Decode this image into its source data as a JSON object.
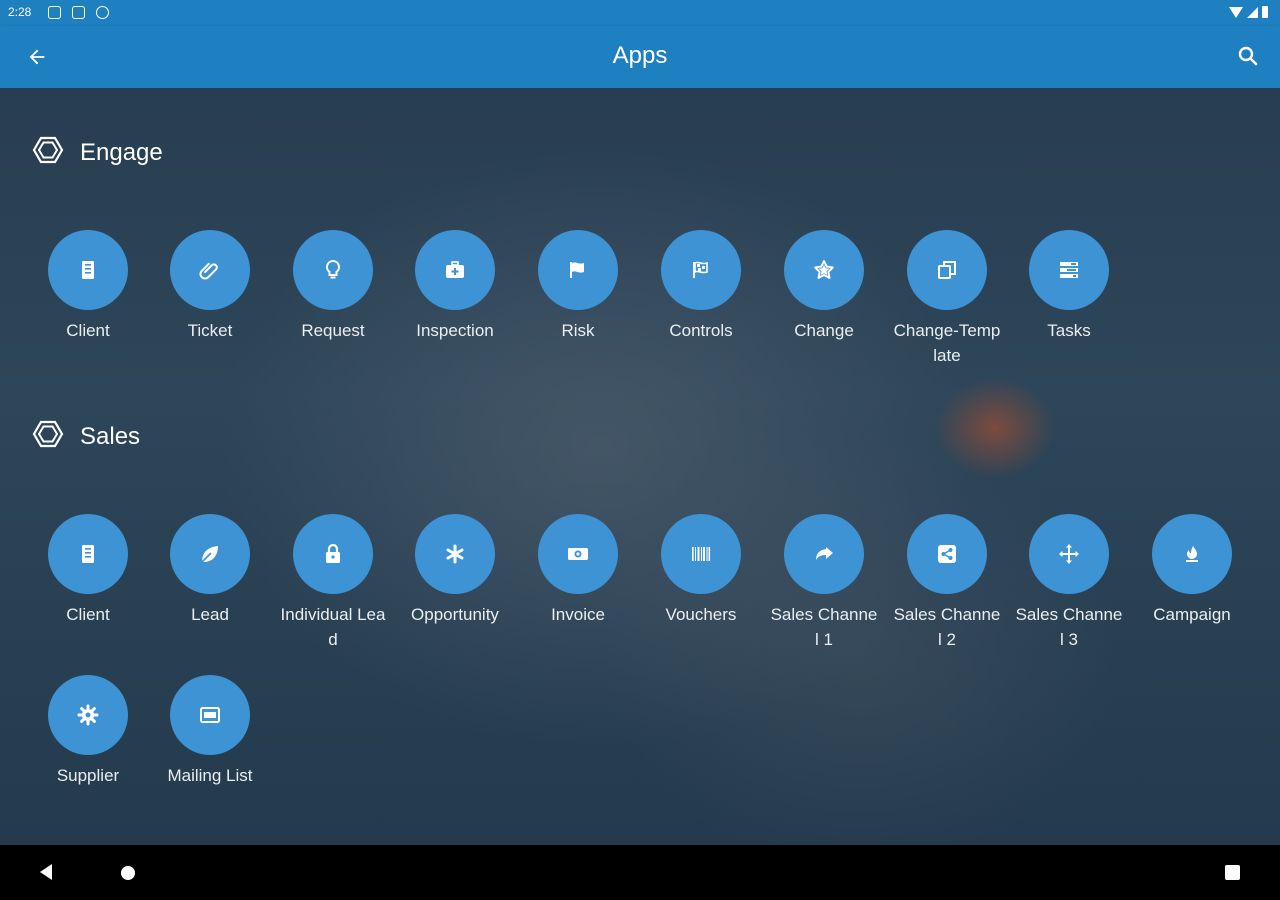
{
  "status_bar": {
    "time": "2:28"
  },
  "app_bar": {
    "title": "Apps"
  },
  "sections": [
    {
      "title": "Engage",
      "apps": [
        {
          "label": "Client",
          "icon": "clipboard-icon"
        },
        {
          "label": "Ticket",
          "icon": "paperclip-icon"
        },
        {
          "label": "Request",
          "icon": "lightbulb-icon"
        },
        {
          "label": "Inspection",
          "icon": "medkit-icon"
        },
        {
          "label": "Risk",
          "icon": "flag-icon"
        },
        {
          "label": "Controls",
          "icon": "checkered-flag-icon"
        },
        {
          "label": "Change",
          "icon": "star-icon"
        },
        {
          "label": "Change-Template",
          "icon": "copy-icon"
        },
        {
          "label": "Tasks",
          "icon": "tasks-icon"
        }
      ]
    },
    {
      "title": "Sales",
      "apps": [
        {
          "label": "Client",
          "icon": "clipboard-icon"
        },
        {
          "label": "Lead",
          "icon": "leaf-icon"
        },
        {
          "label": "Individual Lead",
          "icon": "lock-icon"
        },
        {
          "label": "Opportunity",
          "icon": "asterisk-icon"
        },
        {
          "label": "Invoice",
          "icon": "money-icon"
        },
        {
          "label": "Vouchers",
          "icon": "barcode-icon"
        },
        {
          "label": "Sales Channel 1",
          "icon": "share-arrow-icon"
        },
        {
          "label": "Sales Channel 2",
          "icon": "share-nodes-icon"
        },
        {
          "label": "Sales Channel 3",
          "icon": "move-icon"
        },
        {
          "label": "Campaign",
          "icon": "fire-extinguisher-icon"
        },
        {
          "label": "Supplier",
          "icon": "gear-icon"
        },
        {
          "label": "Mailing List",
          "icon": "list-box-icon"
        }
      ]
    }
  ],
  "colors": {
    "app_bar": "#1e7fc1",
    "tile": "#3d93d4",
    "nav_bar": "#000000"
  }
}
